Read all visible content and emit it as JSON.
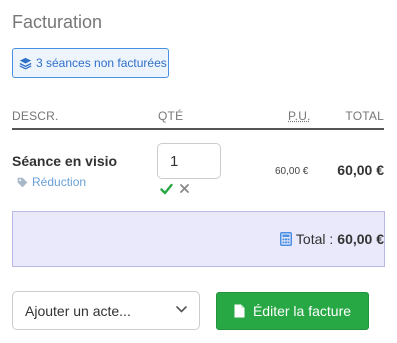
{
  "panel": {
    "title": "Facturation"
  },
  "sessions_badge": {
    "label": "3 séances non facturées",
    "icon": "layers-icon"
  },
  "table": {
    "headers": {
      "descr": "DESCR.",
      "qty": "QTÉ",
      "unit_price": "P.U.",
      "total": "TOTAL"
    },
    "rows": [
      {
        "title": "Séance en visio",
        "discount_label": "Réduction",
        "quantity": "1",
        "unit_price": "60,00 €",
        "total": "60,00 €"
      }
    ]
  },
  "summary": {
    "label": "Total :",
    "amount": "60,00 €"
  },
  "footer": {
    "add_act_placeholder": "Ajouter un acte...",
    "edit_invoice_label": "Éditer la facture"
  },
  "colors": {
    "accent_blue": "#4a90e2",
    "success_green": "#28a745",
    "total_panel_bg": "#e9e9fb"
  }
}
